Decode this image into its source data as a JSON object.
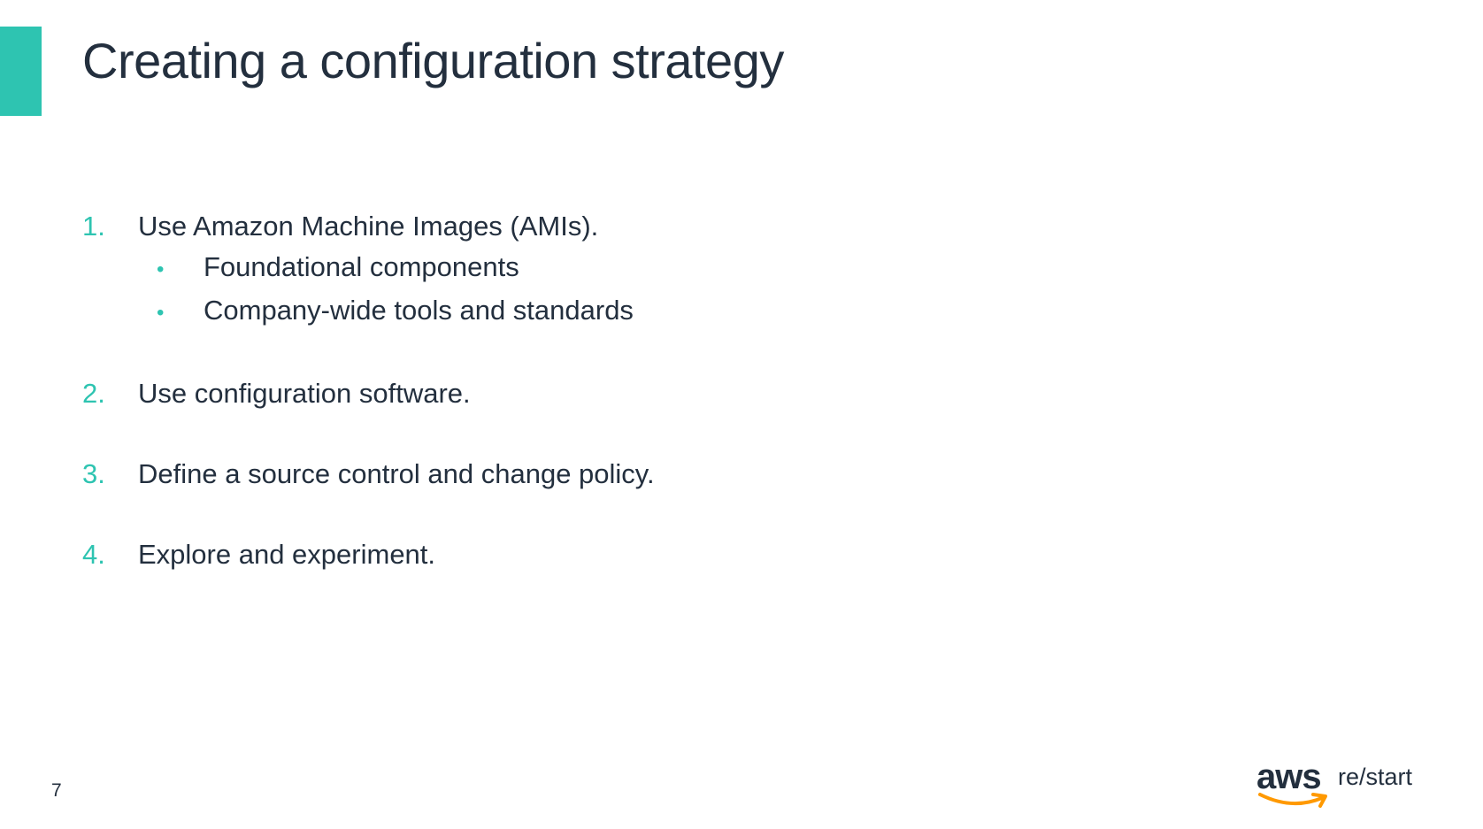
{
  "slide": {
    "title": "Creating a configuration strategy",
    "page_number": "7",
    "accent_color": "#2ec4b1",
    "text_color": "#232f3e"
  },
  "items": [
    {
      "number": "1.",
      "text": "Use Amazon Machine Images (AMIs).",
      "subitems": [
        {
          "bullet": "•",
          "text": "Foundational components"
        },
        {
          "bullet": "•",
          "text": "Company-wide tools and standards"
        }
      ]
    },
    {
      "number": "2.",
      "text": "Use configuration software."
    },
    {
      "number": "3.",
      "text": "Define a source control and change policy."
    },
    {
      "number": "4.",
      "text": "Explore and experiment."
    }
  ],
  "logo": {
    "aws": "aws",
    "restart": "re/start",
    "smile_color": "#ff9900",
    "icon": "aws-smile-arrow"
  }
}
